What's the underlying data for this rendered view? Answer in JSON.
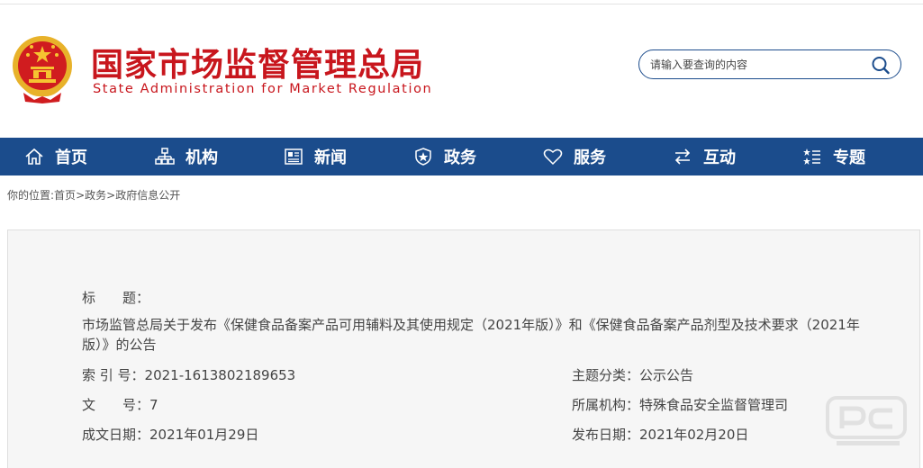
{
  "header": {
    "title_cn": "国家市场监督管理总局",
    "title_en": "State Administration for Market Regulation",
    "emblem_icon": "national-emblem-icon"
  },
  "search": {
    "placeholder": "请输入要查询的内容",
    "icon": "search-icon"
  },
  "nav": {
    "items": [
      {
        "label": "首页",
        "icon": "home-icon"
      },
      {
        "label": "机构",
        "icon": "org-chart-icon"
      },
      {
        "label": "新闻",
        "icon": "news-icon"
      },
      {
        "label": "政务",
        "icon": "shield-icon"
      },
      {
        "label": "服务",
        "icon": "heart-icon"
      },
      {
        "label": "互动",
        "icon": "exchange-arrows-icon"
      },
      {
        "label": "专题",
        "icon": "special-topic-icon"
      }
    ]
  },
  "breadcrumb": {
    "prefix": "你的位置:",
    "items": [
      "首页",
      "政务",
      "政府信息公开"
    ],
    "separator": ">"
  },
  "info": {
    "title_label": "标　　题：",
    "title_value": "市场监管总局关于发布《保健食品备案产品可用辅料及其使用规定（2021年版）》和《保健食品备案产品剂型及技术要求（2021年版）》的公告",
    "index_label": "索 引 号：",
    "index_value": "2021-1613802189653",
    "category_label": "主题分类：",
    "category_value": "公示公告",
    "doc_no_label": "文　　号：",
    "doc_no_value": "7",
    "org_label": "所属机构：",
    "org_value": "特殊食品安全监督管理司",
    "created_label": "成文日期：",
    "created_value": "2021年01月29日",
    "published_label": "发布日期：",
    "published_value": "2021年02月20日"
  },
  "colors": {
    "brand_red": "#c8161d",
    "nav_blue": "#1b4c8c",
    "panel_bg": "#f6f6f6"
  }
}
